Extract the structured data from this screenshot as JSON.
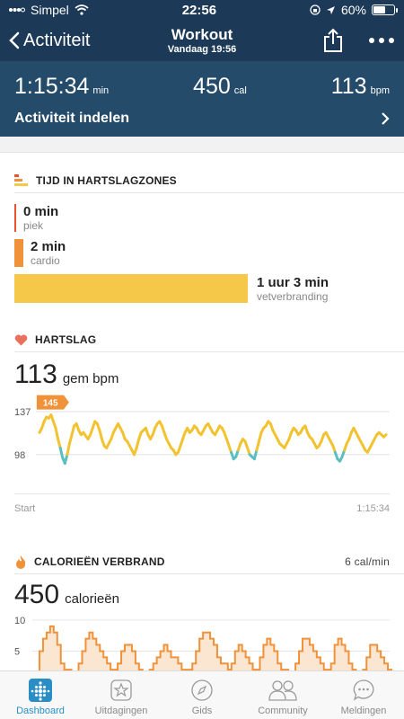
{
  "status_bar": {
    "carrier": "Simpel",
    "time": "22:56",
    "battery": "60%",
    "battery_level": 0.6
  },
  "header": {
    "back_label": "Activiteit",
    "title": "Workout",
    "subtitle": "Vandaag 19:56"
  },
  "summary": {
    "duration": "1:15:34",
    "duration_unit": "min",
    "calories": "450",
    "calories_unit": "cal",
    "heart_rate": "113",
    "heart_rate_unit": "bpm",
    "link_label": "Activiteit indelen"
  },
  "zones": {
    "title": "TIJD IN HARTSLAGZONES",
    "peak": {
      "value": "0 min",
      "label": "piek",
      "color": "#e8522e"
    },
    "cardio": {
      "value": "2 min",
      "label": "cardio",
      "color": "#f0923a"
    },
    "fat_burn": {
      "value": "1 uur 3 min",
      "label": "vetverbranding",
      "color": "#f5c84a"
    }
  },
  "heart_rate": {
    "title": "HARTSLAG",
    "avg": "113",
    "avg_label": "gem bpm",
    "start_label": "Start",
    "end_label": "1:15:34"
  },
  "calories": {
    "title": "CALORIEËN VERBRAND",
    "rate": "6 cal/min",
    "total": "450",
    "total_label": "calorieën"
  },
  "tabs": [
    {
      "label": "Dashboard",
      "icon": "fitbit-dots-icon",
      "active": true
    },
    {
      "label": "Uitdagingen",
      "icon": "star-badge-icon",
      "active": false
    },
    {
      "label": "Gids",
      "icon": "compass-icon",
      "active": false
    },
    {
      "label": "Community",
      "icon": "people-icon",
      "active": false
    },
    {
      "label": "Meldingen",
      "icon": "chat-bubble-icon",
      "active": false
    }
  ],
  "chart_data": [
    {
      "type": "line",
      "title": "HARTSLAG",
      "y_ticks": [
        98,
        137
      ],
      "ylim": [
        75,
        150
      ],
      "x_labels": [
        "Start",
        "1:15:34"
      ],
      "max_label": "145",
      "colors": {
        "fat_burn": "#f2c230",
        "below": "#5bbfc0"
      },
      "series": [
        {
          "values": [
            118,
            122,
            128,
            132,
            131,
            134,
            128,
            122,
            112,
            104,
            95,
            90,
            98,
            108,
            116,
            124,
            126,
            120,
            116,
            118,
            115,
            112,
            116,
            122,
            128,
            126,
            120,
            112,
            106,
            104,
            108,
            112,
            118,
            122,
            126,
            122,
            118,
            112,
            110,
            106,
            102,
            98,
            104,
            112,
            118,
            120,
            122,
            116,
            112,
            116,
            122,
            126,
            128,
            124,
            118,
            112,
            108,
            104,
            102,
            98,
            100,
            106,
            112,
            118,
            122,
            118,
            120,
            124,
            122,
            118,
            116,
            120,
            124,
            126,
            122,
            118,
            116,
            120,
            124,
            122,
            118,
            112,
            106,
            100,
            94,
            96,
            102,
            108,
            112,
            110,
            104,
            98,
            96,
            94,
            102,
            110,
            118,
            122,
            124,
            128,
            126,
            120,
            116,
            112,
            108,
            106,
            104,
            108,
            112,
            118,
            122,
            120,
            116,
            118,
            122,
            124,
            118,
            114,
            112,
            108,
            104,
            106,
            110,
            116,
            118,
            114,
            110,
            106,
            100,
            94,
            92,
            96,
            102,
            108,
            112,
            118,
            122,
            118,
            114,
            110,
            106,
            102,
            100,
            104,
            108,
            112,
            116,
            118,
            116,
            114,
            116
          ]
        }
      ]
    },
    {
      "type": "area",
      "title": "CALORIEËN VERBRAND",
      "y_ticks": [
        5,
        10
      ],
      "ylim": [
        0,
        11
      ],
      "series": [
        {
          "values": [
            1,
            5,
            7,
            8,
            9,
            8,
            6,
            3,
            2,
            2,
            1,
            1,
            3,
            5,
            7,
            8,
            7,
            6,
            5,
            4,
            3,
            2,
            2,
            3,
            5,
            6,
            6,
            5,
            3,
            2,
            1,
            1,
            2,
            3,
            4,
            5,
            6,
            5,
            4,
            4,
            3,
            2,
            2,
            2,
            3,
            5,
            7,
            8,
            8,
            7,
            6,
            4,
            3,
            3,
            2,
            3,
            5,
            6,
            5,
            4,
            3,
            2,
            2,
            4,
            6,
            7,
            6,
            5,
            3,
            2,
            2,
            1,
            1,
            3,
            5,
            7,
            7,
            6,
            5,
            4,
            3,
            2,
            2,
            3,
            6,
            7,
            6,
            5,
            3,
            2,
            1,
            1,
            2,
            4,
            6,
            6,
            5,
            4,
            3,
            2
          ]
        }
      ]
    }
  ]
}
